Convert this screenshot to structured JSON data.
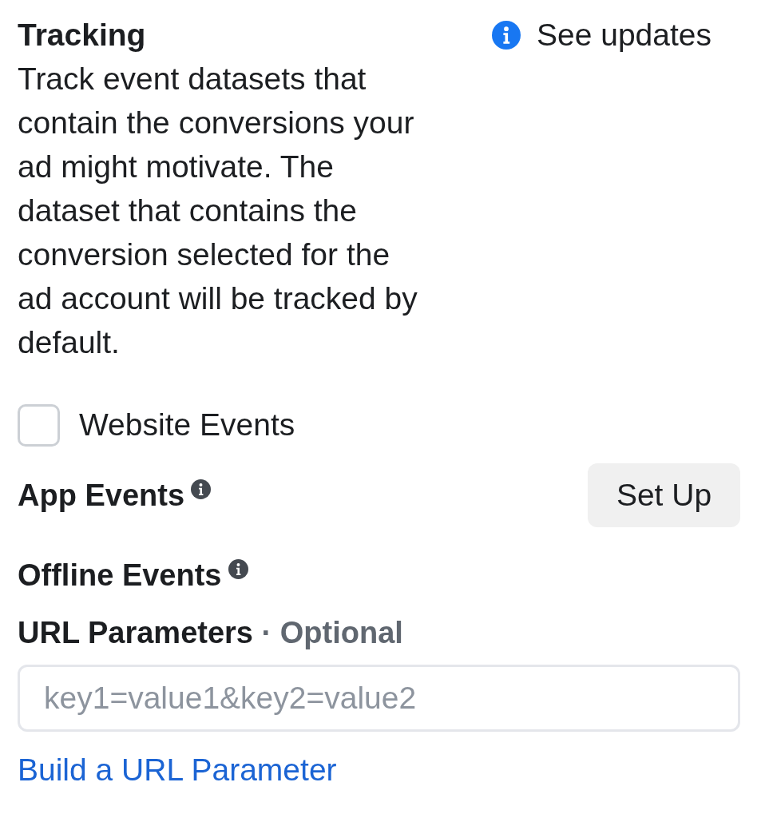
{
  "tracking": {
    "title": "Tracking",
    "description": "Track event datasets that contain the conversions your ad might motivate. The dataset that contains the conversion selected for the ad account will be tracked by default.",
    "updates_link": "See updates"
  },
  "events": [
    {
      "kind": "checkbox",
      "label": "Website Events",
      "checked": false
    },
    {
      "kind": "info",
      "label": "App Events",
      "button": "Set Up"
    },
    {
      "kind": "info",
      "label": "Offline Events"
    }
  ],
  "url_parameters": {
    "label": "URL Parameters",
    "optional": "· Optional",
    "placeholder": "key1=value1&key2=value2",
    "link": "Build a URL Parameter"
  }
}
